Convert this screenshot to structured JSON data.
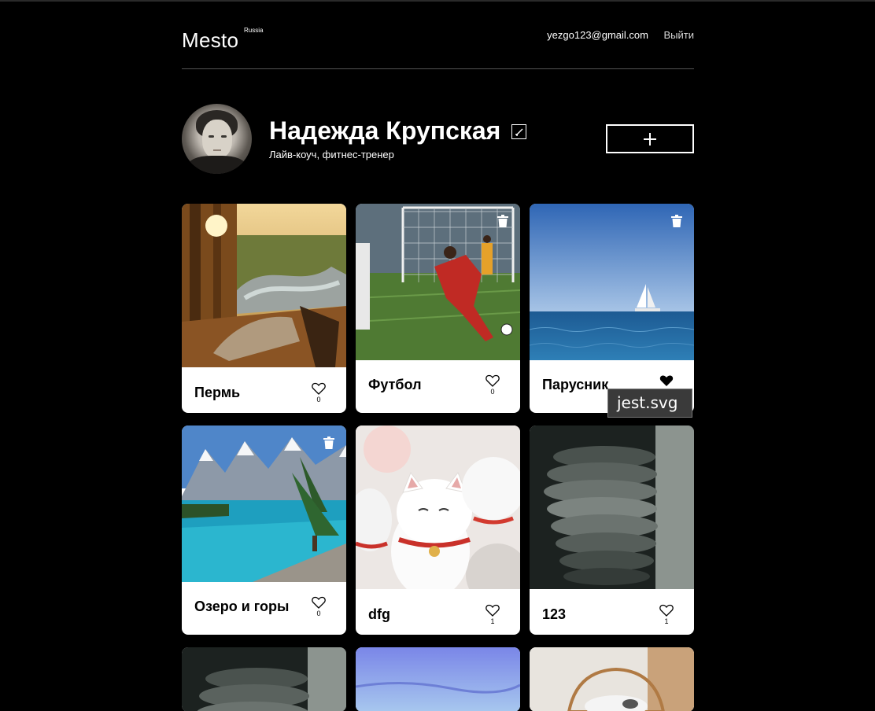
{
  "header": {
    "logo": "Mesto",
    "logo_sup": "Russia",
    "email": "yezgo123@gmail.com",
    "logout": "Выйти"
  },
  "profile": {
    "name": "Надежда Крупская",
    "about": "Лайв-коуч, фитнес-тренер"
  },
  "cards": [
    {
      "title": "Пермь",
      "likes": "0",
      "liked": false,
      "deletable": false
    },
    {
      "title": "Футбол",
      "likes": "0",
      "liked": false,
      "deletable": true
    },
    {
      "title": "Парусник",
      "likes": "",
      "liked": true,
      "deletable": true
    },
    {
      "title": "Озеро и горы",
      "likes": "0",
      "liked": false,
      "deletable": true
    },
    {
      "title": "dfg",
      "likes": "1",
      "liked": false,
      "deletable": false
    },
    {
      "title": "123",
      "likes": "1",
      "liked": false,
      "deletable": false
    }
  ],
  "tooltip": {
    "text": "jest.svg"
  },
  "colors": {
    "background": "#000000",
    "card": "#ffffff",
    "text": "#ffffff"
  }
}
